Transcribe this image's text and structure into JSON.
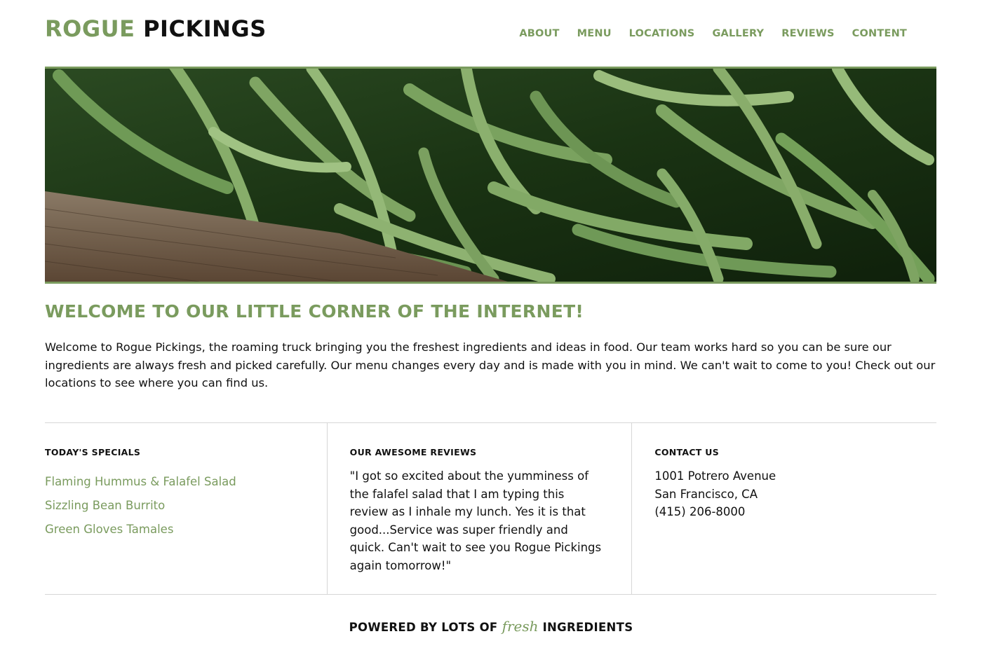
{
  "brand": {
    "name_part1": "ROGUE",
    "name_part2": "PICKINGS"
  },
  "nav": {
    "items": [
      "ABOUT",
      "MENU",
      "LOCATIONS",
      "GALLERY",
      "REVIEWS",
      "CONTENT"
    ]
  },
  "hero": {
    "image": "green-beans-photo"
  },
  "welcome": {
    "title": "WELCOME TO OUR LITTLE CORNER OF THE INTERNET!",
    "text": "Welcome to Rogue Pickings, the roaming truck bringing you the freshest ingredients and ideas in food. Our team works hard so you can be sure our ingredients are always fresh and picked carefully. Our menu changes every day and is made with you in mind. We can't wait to come to you! Check out our locations to see where you can find us."
  },
  "specials": {
    "title": "TODAY'S SPECIALS",
    "items": [
      "Flaming Hummus & Falafel Salad",
      "Sizzling Bean Burrito",
      "Green Gloves Tamales"
    ]
  },
  "reviews": {
    "title": "OUR AWESOME REVIEWS",
    "quote": "\"I got so excited about the yumminess of the falafel salad that I am typing this review as I inhale my lunch. Yes it is that good...Service was super friendly and quick. Can't wait to see you Rogue Pickings again tomorrow!\""
  },
  "contact": {
    "title": "CONTACT US",
    "address1": "1001 Potrero Avenue",
    "address2": "San Francisco, CA",
    "phone": "(415) 206-8000"
  },
  "footer": {
    "prefix": "POWERED BY LOTS OF",
    "accent": "fresh",
    "suffix": "INGREDIENTS"
  },
  "colors": {
    "accent": "#7a9b5e",
    "text": "#111111",
    "divider": "#d6d6d6"
  }
}
